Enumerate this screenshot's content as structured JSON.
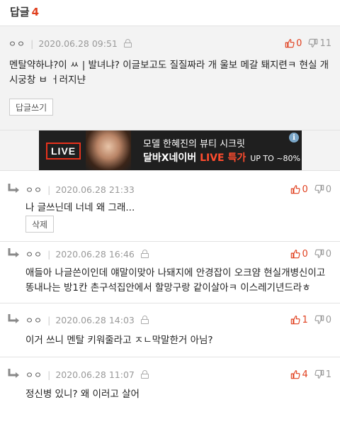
{
  "header": {
    "title": "답글",
    "count": "4"
  },
  "comments": [
    {
      "nick": "ㅇㅇ",
      "date": "2020.06.28 09:51",
      "up": "0",
      "down": "11",
      "text": "멘탈약하냐?이 ㅆ  | 발녀냐? 이글보고도 질질짜라 개 울보 메갈 퇘지련ㅋ 현실 개시궁창 ㅂ ㅓ러지냔",
      "button": "답글쓰기"
    },
    {
      "nick": "ㅇㅇ",
      "date": "2020.06.28 21:33",
      "up": "0",
      "down": "0",
      "text": "나 글쓰닌데 너네 왜 그래...",
      "button": "삭제"
    },
    {
      "nick": "ㅇㅇ",
      "date": "2020.06.28 16:46",
      "up": "0",
      "down": "0",
      "text": "애들아 나글쓴이인데 얘말이맞아 나돼지에 안경잡이 오크얌 현실개병신이고 똥내나는 방1칸 촌구석집안에서 할망구랑 같이살아ㅋ 이스레기년드라ㅎ"
    },
    {
      "nick": "ㅇㅇ",
      "date": "2020.06.28 14:03",
      "up": "1",
      "down": "0",
      "text": "이거 쓰니 멘탈 키워줄라고 ㅈㄴ막말한거 아님?"
    },
    {
      "nick": "ㅇㅇ",
      "date": "2020.06.28 11:07",
      "up": "4",
      "down": "1",
      "text": "정신병 있니? 왜 이러고 살어"
    }
  ],
  "ad": {
    "badge": "LIVE",
    "line1": "모델 한혜진의 뷰티 시크릿",
    "line2_a": "달바X네이버 ",
    "line2_b": "LIVE 특가",
    "line2_c": "UP TO ~80%",
    "info": "i"
  },
  "colors": {
    "accent": "#e0401f",
    "muted": "#999999",
    "reply_bg": "#f3f3f3"
  }
}
